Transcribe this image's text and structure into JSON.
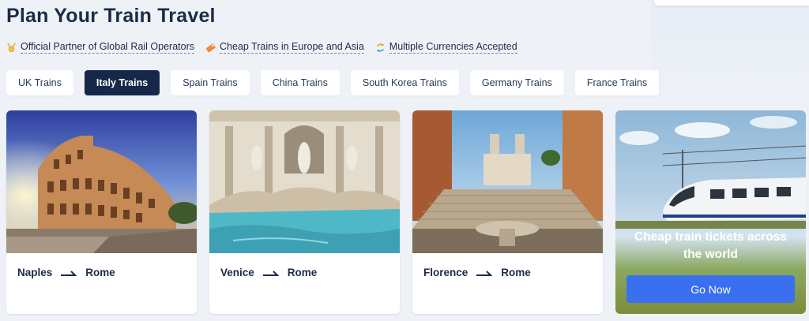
{
  "page": {
    "title": "Plan Your Train Travel"
  },
  "features": [
    {
      "icon": "medal-icon",
      "label": "Official Partner of Global Rail Operators"
    },
    {
      "icon": "ticket-icon",
      "label": "Cheap Trains in Europe and Asia"
    },
    {
      "icon": "currency-exchange-icon",
      "label": "Multiple Currencies Accepted"
    }
  ],
  "tabs": [
    {
      "label": "UK Trains",
      "active": false
    },
    {
      "label": "Italy Trains",
      "active": true
    },
    {
      "label": "Spain Trains",
      "active": false
    },
    {
      "label": "China Trains",
      "active": false
    },
    {
      "label": "South Korea Trains",
      "active": false
    },
    {
      "label": "Germany Trains",
      "active": false
    },
    {
      "label": "France Trains",
      "active": false
    }
  ],
  "routes": [
    {
      "from": "Naples",
      "to": "Rome",
      "image": "colosseum-photo"
    },
    {
      "from": "Venice",
      "to": "Rome",
      "image": "trevi-fountain-photo"
    },
    {
      "from": "Florence",
      "to": "Rome",
      "image": "spanish-steps-photo"
    }
  ],
  "promo": {
    "text": "Cheap train tickets across the world",
    "button": "Go Now",
    "image": "high-speed-train-photo"
  },
  "colors": {
    "active_tab": "#16284a",
    "button": "#3a6ff0",
    "text": "#1c2b46"
  }
}
